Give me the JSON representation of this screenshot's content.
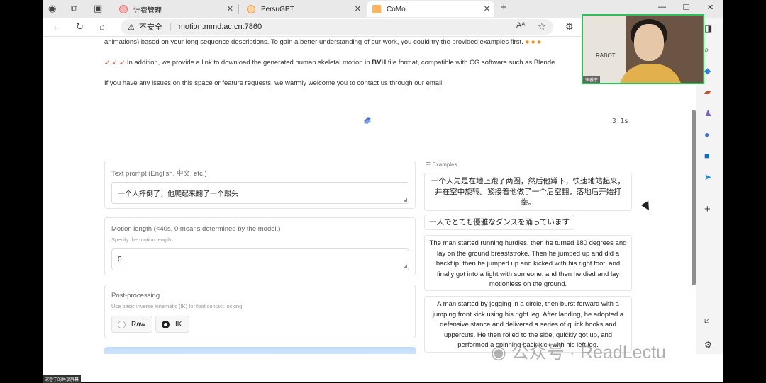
{
  "browser": {
    "tabs": [
      {
        "label": "计费管理"
      },
      {
        "label": "PersuGPT"
      },
      {
        "label": "CoMo"
      }
    ],
    "address": {
      "security": "不安全",
      "url": "motion.mmd.ac.cn:7860"
    },
    "reading_aloud": "Aᴬ"
  },
  "page": {
    "intro_line": "animations) based on your long sequence descriptions. To gain a better understanding of our work, you could try the provided examples first.",
    "bvh_line_pre": "In addition, we provide a link to download the generated human skeletal motion in",
    "bvh_bold": "BVH",
    "bvh_line_post": "file format, compatible with CG software such as Blende",
    "contact_pre": "If you have any issues on this space or feature requests, we warmly welcome you to contact us through our",
    "contact_link": "email",
    "contact_post": ".",
    "timer": "3.1s"
  },
  "form": {
    "text_prompt": {
      "label": "Text prompt (English, 中文, etc.)",
      "value": "一个人摔倒了，他爬起来翻了一个跟头"
    },
    "motion_length": {
      "label": "Motion length (<40s, 0 means determined by the model.)",
      "hint": "Specify the motion length;",
      "value": "0"
    },
    "post_processing": {
      "label": "Post-processing",
      "hint": "Use basic inverse kinematic (IK) for foot contact locking",
      "options": [
        "Raw",
        "IK"
      ],
      "selected": "IK"
    }
  },
  "examples": {
    "heading": "Examples",
    "items": [
      "一个人先是在地上跑了两圈，然后他蹲下，快速地站起来，并在空中旋转。紧接着他做了一个后空翻，落地后开始打拳。",
      "一人でとても優雅なダンスを踊っています",
      "The man started running hurdles, then he turned 180 degrees and lay on the ground breaststroke. Then he jumped up and did a backflip, then he jumped up and kicked with his right foot, and finally got into a fight with someone, and then he died and lay motionless on the ground.",
      "A man started by jogging in a circle, then burst forward with a jumping front kick using his right leg. After landing, he adopted a defensive stance and delivered a series of quick hooks and uppercuts. He then rolled to the side, quickly got up, and performed a spinning back kick with his left leg."
    ]
  },
  "overlay": {
    "watermark": "公众号 · ReadLectu",
    "webcam_name": "宋睿宁",
    "webcam_sign": "RABOT",
    "share_label": "宋睿宁的共享屏幕"
  }
}
